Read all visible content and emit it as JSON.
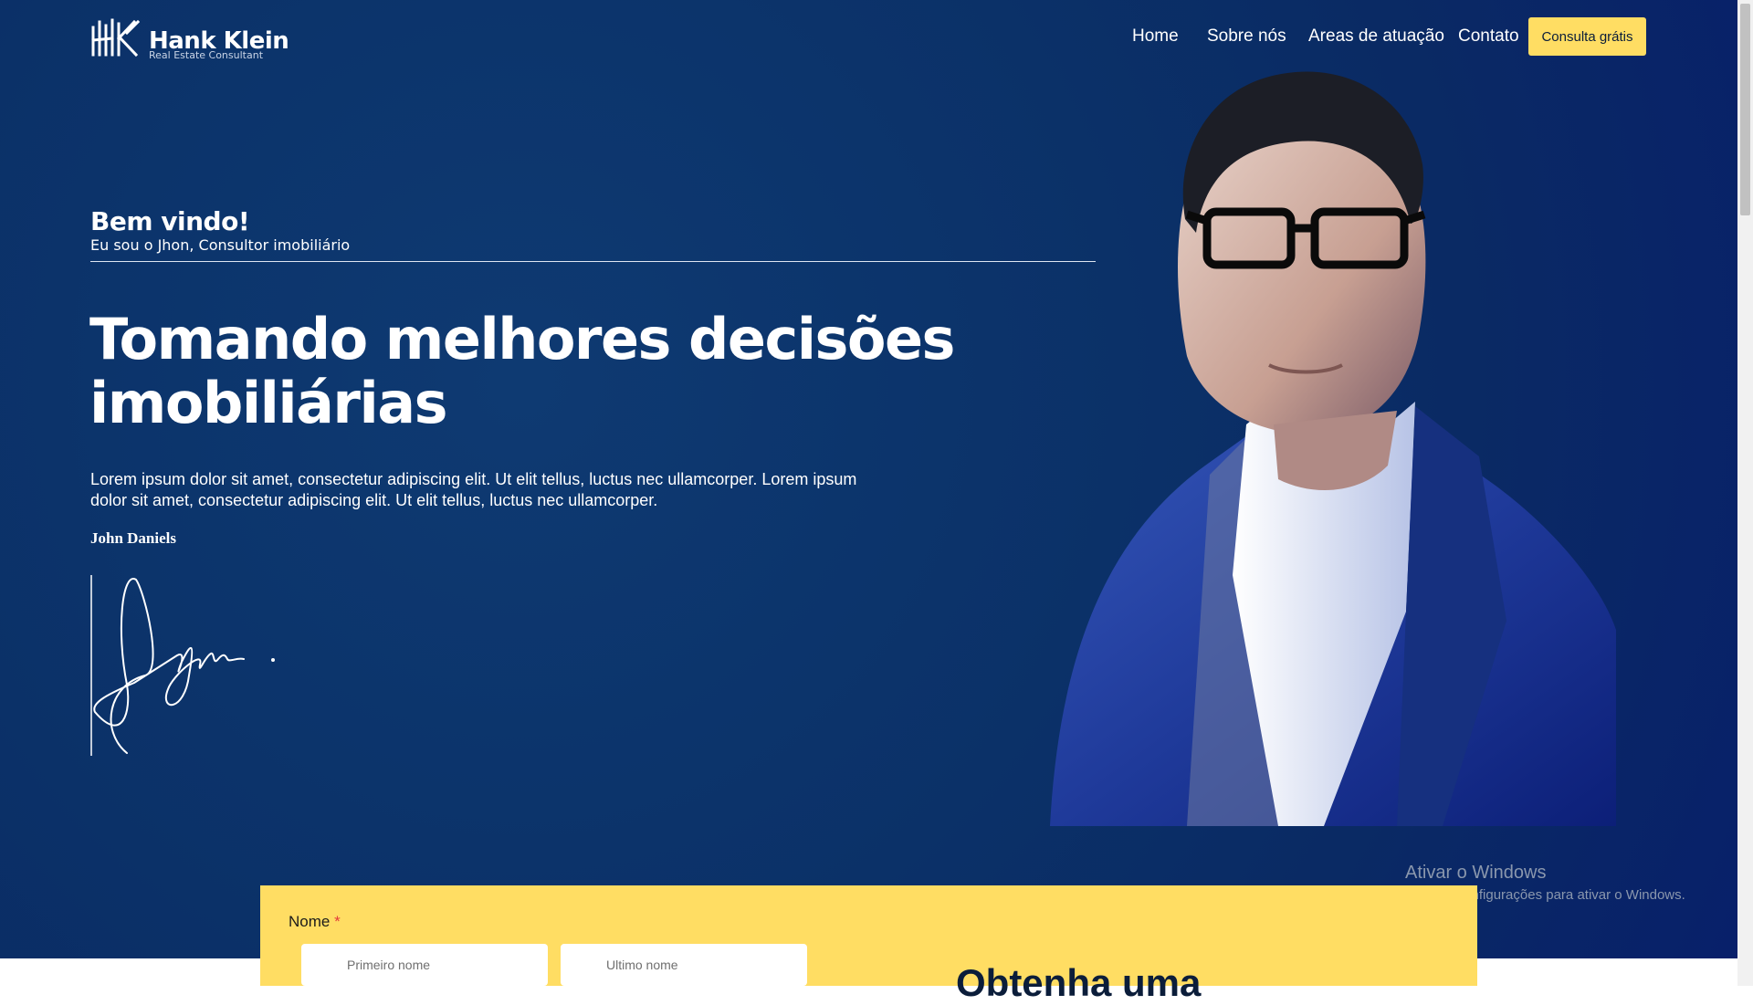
{
  "brand": {
    "name": "Hank Klein",
    "tagline": "Real Estate Consultant"
  },
  "nav": {
    "items": [
      "Home",
      "Sobre nós",
      "Areas de atuação",
      "Contato"
    ],
    "cta": "Consulta grátis"
  },
  "hero": {
    "welcome": "Bem vindo!",
    "subtitle": "Eu sou o Jhon, Consultor imobiliário",
    "headline": "Tomando melhores decisões imobiliárias",
    "paragraph": "Lorem ipsum dolor sit amet, consectetur adipiscing elit. Ut elit tellus, luctus nec ullamcorper. Lorem ipsum dolor sit amet, consectetur adipiscing elit. Ut elit tellus, luctus nec ullamcorper.",
    "author": "John Daniels"
  },
  "form": {
    "name_label": "Nome",
    "required_mark": "*",
    "first_placeholder": "Primeiro nome",
    "last_placeholder": "Ultimo nome",
    "heading": "Obtenha uma"
  },
  "watermark": {
    "title": "Ativar o Windows",
    "subtitle": "Acesse Configurações para ativar o Windows."
  },
  "colors": {
    "hero_bg": "#0b3168",
    "accent_yellow": "#ffdd63",
    "text_white": "#ffffff"
  }
}
